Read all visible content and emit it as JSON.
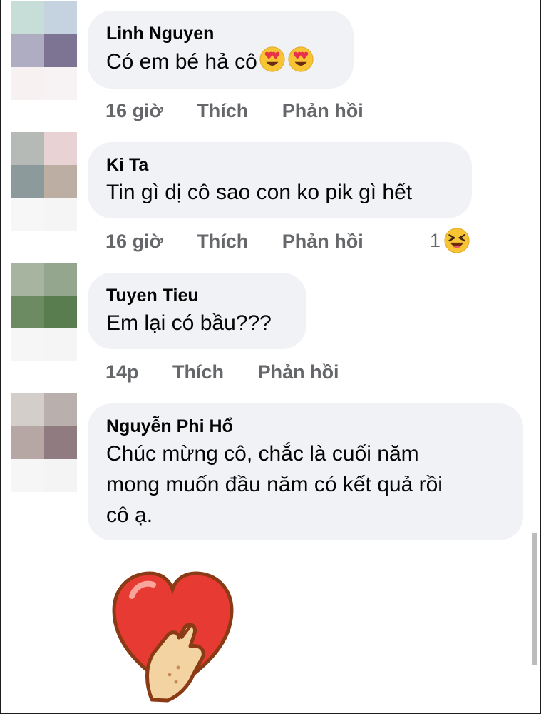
{
  "comments": [
    {
      "author": "Linh Nguyen",
      "text": "Có em bé hả cô",
      "emojis": [
        "heart-eyes-emoji",
        "heart-eyes-emoji"
      ],
      "time": "16 giờ",
      "like_label": "Thích",
      "reply_label": "Phản hồi",
      "avatar_colors": [
        "#c6ddd8",
        "#c5d2e0",
        "#aeadc1",
        "#7d7392",
        "#f7f1f2",
        "#f7f3f4"
      ]
    },
    {
      "author": "Ki Ta",
      "text": "Tin gì dị cô sao con ko pik gì hết",
      "time": "16 giờ",
      "like_label": "Thích",
      "reply_label": "Phản hồi",
      "reaction_count": "1",
      "reaction_icon": "laughing-emoji",
      "avatar_colors": [
        "#b6bab7",
        "#e8d2d3",
        "#8d9a9b",
        "#bdaea4",
        "#f7f7f7",
        "#f5f5f5"
      ]
    },
    {
      "author": "Tuyen Tieu",
      "text": "Em lại có bầu???",
      "time": "14p",
      "like_label": "Thích",
      "reply_label": "Phản hồi",
      "avatar_colors": [
        "#a7b4a0",
        "#95a68e",
        "#6d8b62",
        "#5a7d4f",
        "#f6f6f6",
        "#f5f5f5"
      ]
    },
    {
      "author": "Nguyễn Phi Hổ",
      "text_lines": [
        "Chúc mừng cô, chắc là cuối năm",
        "mong muốn đầu năm có kết quả rồi",
        "cô ạ."
      ],
      "avatar_colors": [
        "#d4cecb",
        "#b9afad",
        "#b7a7a4",
        "#8f7b80",
        "#f6f6f6",
        "#f4f4f4"
      ]
    }
  ],
  "sticker": "heart-hand-sticker",
  "colors": {
    "bubble_bg": "#f0f2f5",
    "action_text": "#65676b",
    "text": "#050505"
  }
}
